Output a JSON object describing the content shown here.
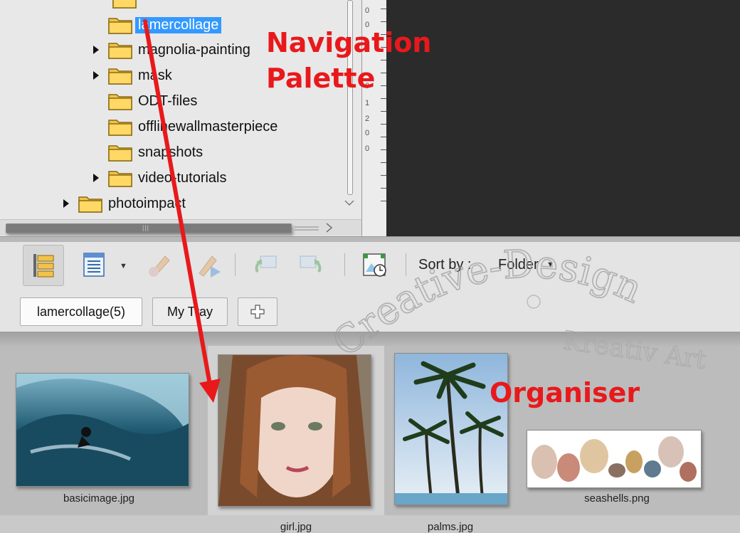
{
  "navigation_palette": {
    "tree": [
      {
        "label": "lamercollage",
        "expandable": false,
        "selected": true
      },
      {
        "label": "magnolia-painting",
        "expandable": true,
        "selected": false
      },
      {
        "label": "mask",
        "expandable": true,
        "selected": false
      },
      {
        "label": "ODT-files",
        "expandable": false,
        "selected": false
      },
      {
        "label": "offlinewallmasterpiece",
        "expandable": false,
        "selected": false
      },
      {
        "label": "snapshots",
        "expandable": false,
        "selected": false
      },
      {
        "label": "video-tutorials",
        "expandable": true,
        "selected": false
      },
      {
        "label": "photoimpact",
        "expandable": true,
        "selected": false
      }
    ]
  },
  "toolbar": {
    "buttons": [
      {
        "icon": "folder-tree-view-icon",
        "active": true
      },
      {
        "icon": "details-view-icon",
        "active": false
      },
      {
        "icon": "edit-pencil-icon",
        "active": false
      },
      {
        "icon": "edit-forward-icon",
        "active": false
      },
      {
        "icon": "rotate-left-icon",
        "active": false
      },
      {
        "icon": "rotate-right-icon",
        "active": false
      },
      {
        "icon": "slideshow-clock-icon",
        "active": false
      }
    ],
    "sort_label": "Sort by :",
    "sort_value": "Folder"
  },
  "tabs": [
    {
      "label": "lamercollage(5)",
      "active": true
    },
    {
      "label": "My Tray",
      "active": false
    },
    {
      "label": "add-tab-icon",
      "active": false
    }
  ],
  "organiser": {
    "files": [
      {
        "name": "basicimage.jpg"
      },
      {
        "name": "girl.jpg"
      },
      {
        "name": "palms.jpg"
      },
      {
        "name": "seashells.png"
      }
    ]
  },
  "annotations": {
    "nav_line1": "Navigation",
    "nav_line2": "Palette",
    "organiser": "Organiser",
    "color": "#e8191b"
  },
  "watermark": {
    "line1": "Creative-Design",
    "line2": "Kreativ Art"
  },
  "ruler_numbers": [
    "0",
    "0",
    "0",
    "1",
    "2",
    "0",
    "0"
  ]
}
